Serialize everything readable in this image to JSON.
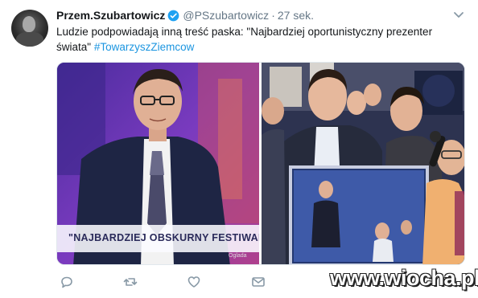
{
  "tweet": {
    "author_name": "Przem.Szubartowicz",
    "handle": "@PSzubartowicz",
    "separator": "·",
    "time": "27 sek.",
    "text_main": "Ludzie podpowiadają inną treść paska: \"Najbardziej oportunistyczny prezenter świata\" ",
    "hashtag": "#TowarzyszZiemcow"
  },
  "media": {
    "left_banner_text": "\"NAJBARDZIEJ OBSKURNY FESTIWAL",
    "left_channel_logo": "Oglada"
  },
  "actions": {
    "reply_icon": "reply-icon",
    "retweet_icon": "retweet-icon",
    "like_icon": "heart-icon",
    "dm_icon": "envelope-icon"
  },
  "watermark": "www.wiocha.pl",
  "colors": {
    "link": "#1b95e0",
    "verified": "#1da1f2",
    "secondary_text": "#657786"
  }
}
